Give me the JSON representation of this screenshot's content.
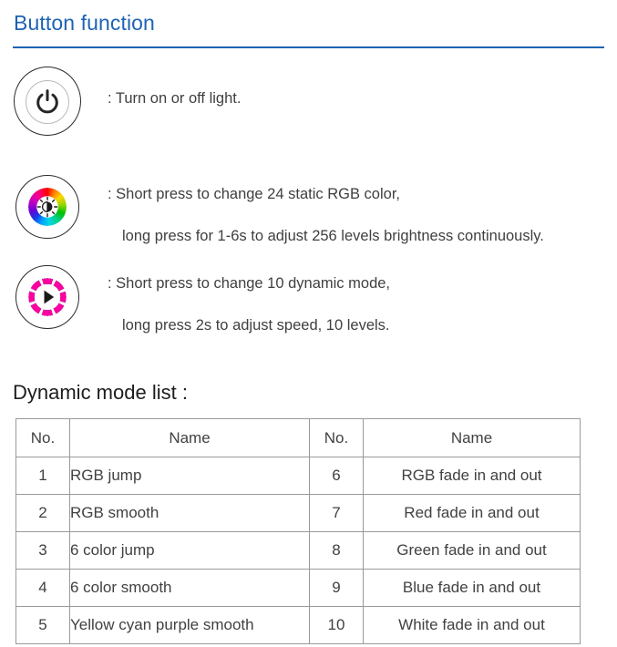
{
  "section": {
    "heading": "Button function"
  },
  "functions": [
    {
      "icon": "power-button-icon",
      "lines": [
        "): Turn on or off light."
      ]
    },
    {
      "icon": "rgb-color-wheel-icon",
      "lines": [
        ": Short press to change 24 static RGB color,",
        "long press for 1-6s to adjust 256 levels brightness continuously."
      ]
    },
    {
      "icon": "dynamic-mode-wheel-icon",
      "lines": [
        ": Short press to change 10 dynamic mode,",
        "long press 2s to adjust speed, 10 levels."
      ]
    }
  ],
  "function_texts": {
    "row1_line1": ": Turn on or off light.",
    "row2_line1": ": Short press to change 24 static RGB color,",
    "row2_line2": "long press for 1-6s to adjust 256 levels brightness continuously.",
    "row3_line1": ": Short press to change 10 dynamic mode,",
    "row3_line2": "long press 2s to adjust speed, 10 levels."
  },
  "mode_list": {
    "heading": "Dynamic mode list :",
    "headers": {
      "no_left": "No.",
      "name_left": "Name",
      "no_right": "No.",
      "name_right": "Name"
    },
    "rows": [
      {
        "no_left": "1",
        "name_left": "RGB jump",
        "no_right": "6",
        "name_right": "RGB fade in and out"
      },
      {
        "no_left": "2",
        "name_left": "RGB smooth",
        "no_right": "7",
        "name_right": "Red fade in and out"
      },
      {
        "no_left": "3",
        "name_left": "6 color jump",
        "no_right": "8",
        "name_right": "Green fade in and out"
      },
      {
        "no_left": "4",
        "name_left": "6 color smooth",
        "no_right": "9",
        "name_right": "Blue fade in and out"
      },
      {
        "no_left": "5",
        "name_left": "Yellow cyan purple smooth",
        "no_right": "10",
        "name_right": "White fade in and out"
      }
    ]
  },
  "colors": {
    "heading_blue": "#1e63b4",
    "body_text": "#3f3f3f",
    "table_border": "#9a9a9a",
    "segment_colors": [
      "#ff0000",
      "#ffd800",
      "#6cdc00",
      "#00e08c",
      "#00d8f0",
      "#1a1aff",
      "#8a00d4",
      "#ff00a0"
    ]
  }
}
